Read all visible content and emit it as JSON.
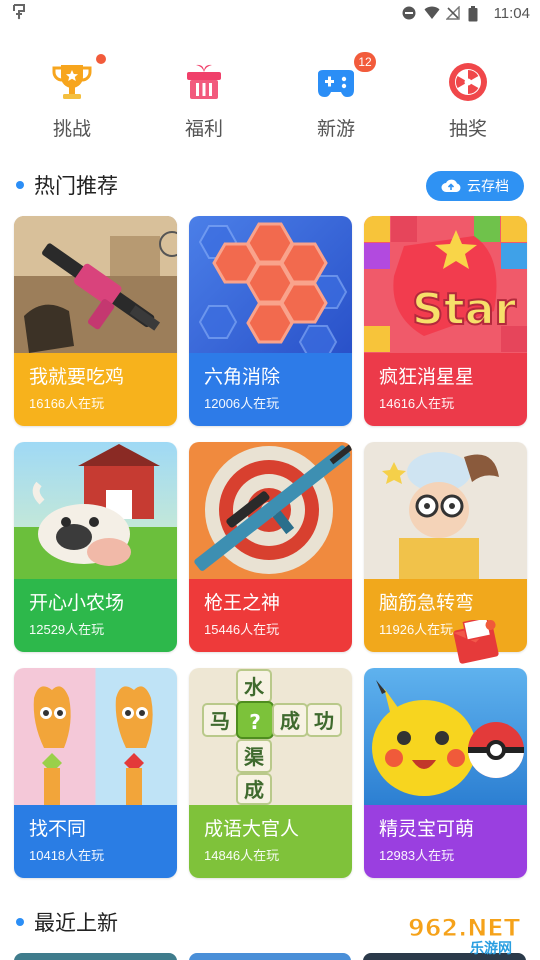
{
  "status_bar": {
    "left_icon": "android-debug-icon",
    "time": "11:04"
  },
  "top_nav": [
    {
      "label": "挑战",
      "icon": "trophy-icon"
    },
    {
      "label": "福利",
      "icon": "gift-icon"
    },
    {
      "label": "新游",
      "icon": "gamepad-icon",
      "badge": "12"
    },
    {
      "label": "抽奖",
      "icon": "prize-wheel-icon"
    }
  ],
  "hot_section": {
    "title": "热门推荐",
    "cloud_button": "云存档"
  },
  "games": [
    {
      "name": "我就要吃鸡",
      "players": "16166人在玩",
      "color": "#f7b21c"
    },
    {
      "name": "六角消除",
      "players": "12006人在玩",
      "color": "#2d7be8"
    },
    {
      "name": "疯狂消星星",
      "players": "14616人在玩",
      "color": "#ec3a4a"
    },
    {
      "name": "开心小农场",
      "players": "12529人在玩",
      "color": "#2db84b"
    },
    {
      "name": "枪王之神",
      "players": "15446人在玩",
      "color": "#ee3a3a"
    },
    {
      "name": "脑筋急转弯",
      "players": "11926人在玩",
      "color": "#f1a81c"
    },
    {
      "name": "找不同",
      "players": "10418人在玩",
      "color": "#2a7de4"
    },
    {
      "name": "成语大官人",
      "players": "14846人在玩",
      "color": "#7fc23a"
    },
    {
      "name": "精灵宝可萌",
      "players": "12983人在玩",
      "color": "#9a3fe0"
    }
  ],
  "new_section": {
    "title": "最近上新"
  },
  "watermark": {
    "text": "962.NET",
    "subtext": "乐游网"
  }
}
